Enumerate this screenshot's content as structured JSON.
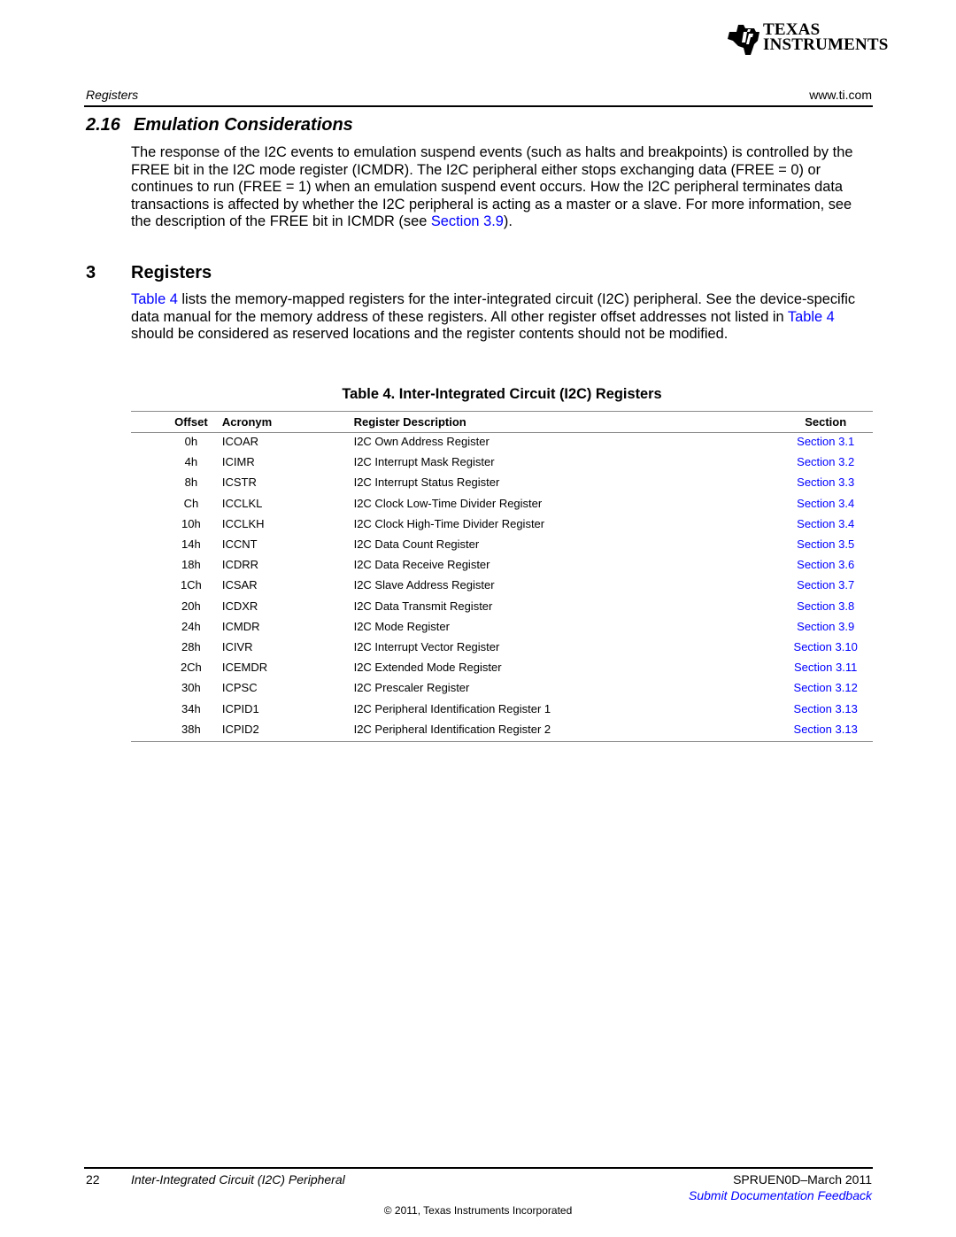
{
  "header": {
    "logo": {
      "line1": "Texas",
      "line2": "Instruments",
      "icon": "ti-logo-icon"
    },
    "section_label": "Registers",
    "website": "www.ti.com"
  },
  "section_216": {
    "number": "2.16",
    "title": "Emulation Considerations",
    "body_before_link": "The response of the I2C events to emulation suspend events (such as halts and breakpoints) is controlled by the FREE bit in the I2C mode register (ICMDR). The I2C peripheral either stops exchanging data (FREE = 0) or continues to run (FREE = 1) when an emulation suspend event occurs. How the I2C peripheral terminates data transactions is affected by whether the I2C peripheral is acting as a master or a slave. For more information, see the description of the FREE bit in ICMDR (see ",
    "link": "Section 3.9",
    "body_after_link": ")."
  },
  "section_3": {
    "number": "3",
    "title": "Registers",
    "link1": "Table 4",
    "text1": " lists the memory-mapped registers for the inter-integrated circuit (I2C) peripheral. See the device-specific data manual for the memory address of these registers. All other register offset addresses not listed in ",
    "link2": "Table 4",
    "text2": " should be considered as reserved locations and the register contents should not be modified."
  },
  "table": {
    "caption": "Table 4. Inter-Integrated Circuit (I2C) Registers",
    "columns": [
      "Offset",
      "Acronym",
      "Register Description",
      "Section"
    ],
    "rows": [
      {
        "offset": "0h",
        "acronym": "ICOAR",
        "description": "I2C Own Address Register",
        "section": "Section 3.1"
      },
      {
        "offset": "4h",
        "acronym": "ICIMR",
        "description": "I2C Interrupt Mask Register",
        "section": "Section 3.2"
      },
      {
        "offset": "8h",
        "acronym": "ICSTR",
        "description": "I2C Interrupt Status Register",
        "section": "Section 3.3"
      },
      {
        "offset": "Ch",
        "acronym": "ICCLKL",
        "description": "I2C Clock Low-Time Divider Register",
        "section": "Section 3.4"
      },
      {
        "offset": "10h",
        "acronym": "ICCLKH",
        "description": "I2C Clock High-Time Divider Register",
        "section": "Section 3.4"
      },
      {
        "offset": "14h",
        "acronym": "ICCNT",
        "description": "I2C Data Count Register",
        "section": "Section 3.5"
      },
      {
        "offset": "18h",
        "acronym": "ICDRR",
        "description": "I2C Data Receive Register",
        "section": "Section 3.6"
      },
      {
        "offset": "1Ch",
        "acronym": "ICSAR",
        "description": "I2C Slave Address Register",
        "section": "Section 3.7"
      },
      {
        "offset": "20h",
        "acronym": "ICDXR",
        "description": "I2C Data Transmit Register",
        "section": "Section 3.8"
      },
      {
        "offset": "24h",
        "acronym": "ICMDR",
        "description": "I2C Mode Register",
        "section": "Section 3.9"
      },
      {
        "offset": "28h",
        "acronym": "ICIVR",
        "description": "I2C Interrupt Vector Register",
        "section": "Section 3.10"
      },
      {
        "offset": "2Ch",
        "acronym": "ICEMDR",
        "description": "I2C Extended Mode Register",
        "section": "Section 3.11"
      },
      {
        "offset": "30h",
        "acronym": "ICPSC",
        "description": "I2C Prescaler Register",
        "section": "Section 3.12"
      },
      {
        "offset": "34h",
        "acronym": "ICPID1",
        "description": "I2C Peripheral Identification Register 1",
        "section": "Section 3.13"
      },
      {
        "offset": "38h",
        "acronym": "ICPID2",
        "description": "I2C Peripheral Identification Register 2",
        "section": "Section 3.13"
      }
    ]
  },
  "footer": {
    "page_number": "22",
    "doc_title": "Inter-Integrated Circuit (I2C) Peripheral",
    "doc_id": "SPRUEN0D–March 2011",
    "feedback_link": "Submit Documentation Feedback",
    "copyright": "© 2011, Texas Instruments Incorporated"
  },
  "colors": {
    "link": "#0000ff",
    "text": "#000000",
    "rule": "#000000",
    "table_rule": "#8a8a8a"
  }
}
